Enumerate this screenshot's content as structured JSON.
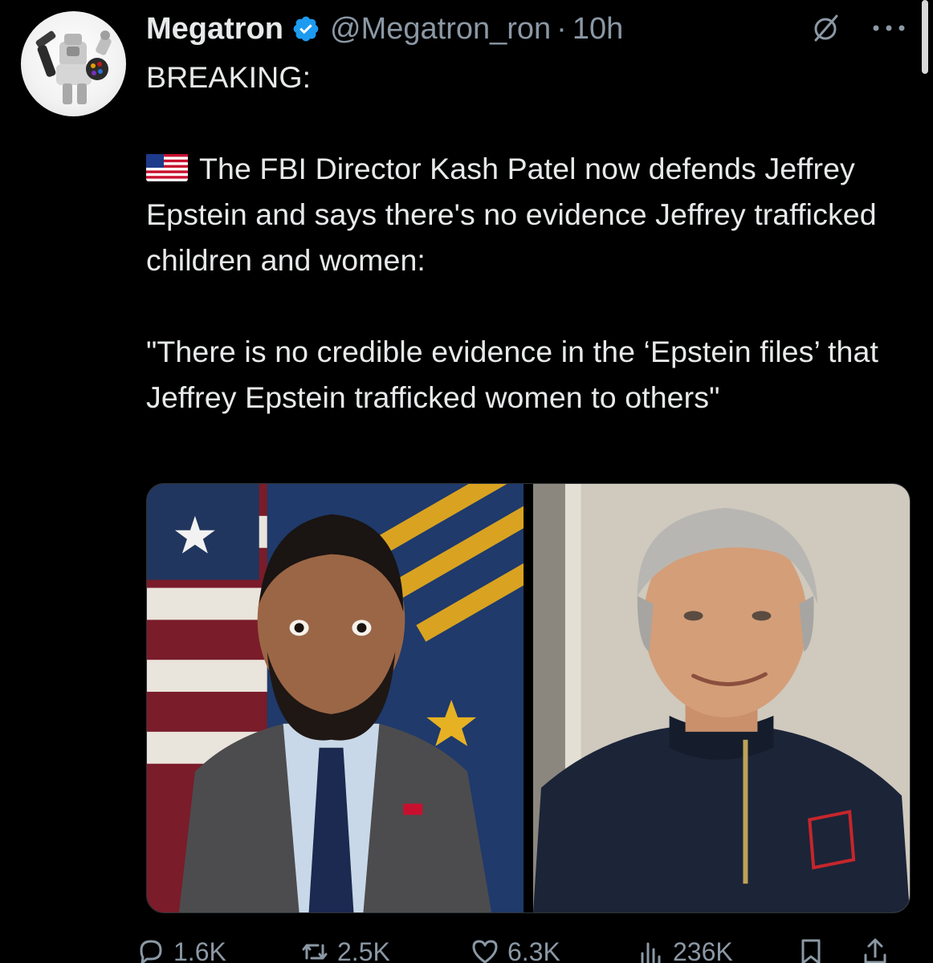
{
  "post": {
    "author": {
      "display_name": "Megatron",
      "handle": "@Megatron_ron",
      "separator": "·",
      "time": "10h",
      "verified": true,
      "avatar_icon": "megatron-avatar"
    },
    "text": {
      "line1": "BREAKING:",
      "flag_icon": "us-flag-emoji",
      "paragraph1": "The FBI Director Kash Patel now defends Jeffrey Epstein and says there's no evidence Jeffrey trafficked children and women:",
      "paragraph2": "\"There is no credible evidence in the ‘Epstein files’ that Jeffrey Epstein trafficked women to others\""
    },
    "media": {
      "left_image": "portrait-man-suit-flag-background",
      "right_image": "portrait-man-navy-sweater",
      "pin_icon": "us-flag-pin"
    },
    "stats": {
      "replies": "1.6K",
      "reposts": "2.5K",
      "likes": "6.3K",
      "views": "236K"
    },
    "icons": {
      "grok": "grok-icon",
      "more": "more-icon",
      "reply": "reply-icon",
      "repost": "repost-icon",
      "like": "heart-icon",
      "views": "views-icon",
      "bookmark": "bookmark-icon",
      "share": "share-icon"
    },
    "colors": {
      "background": "#000000",
      "text": "#e7e9ea",
      "secondary": "#8b98a5",
      "verified": "#1d9bf0"
    }
  }
}
